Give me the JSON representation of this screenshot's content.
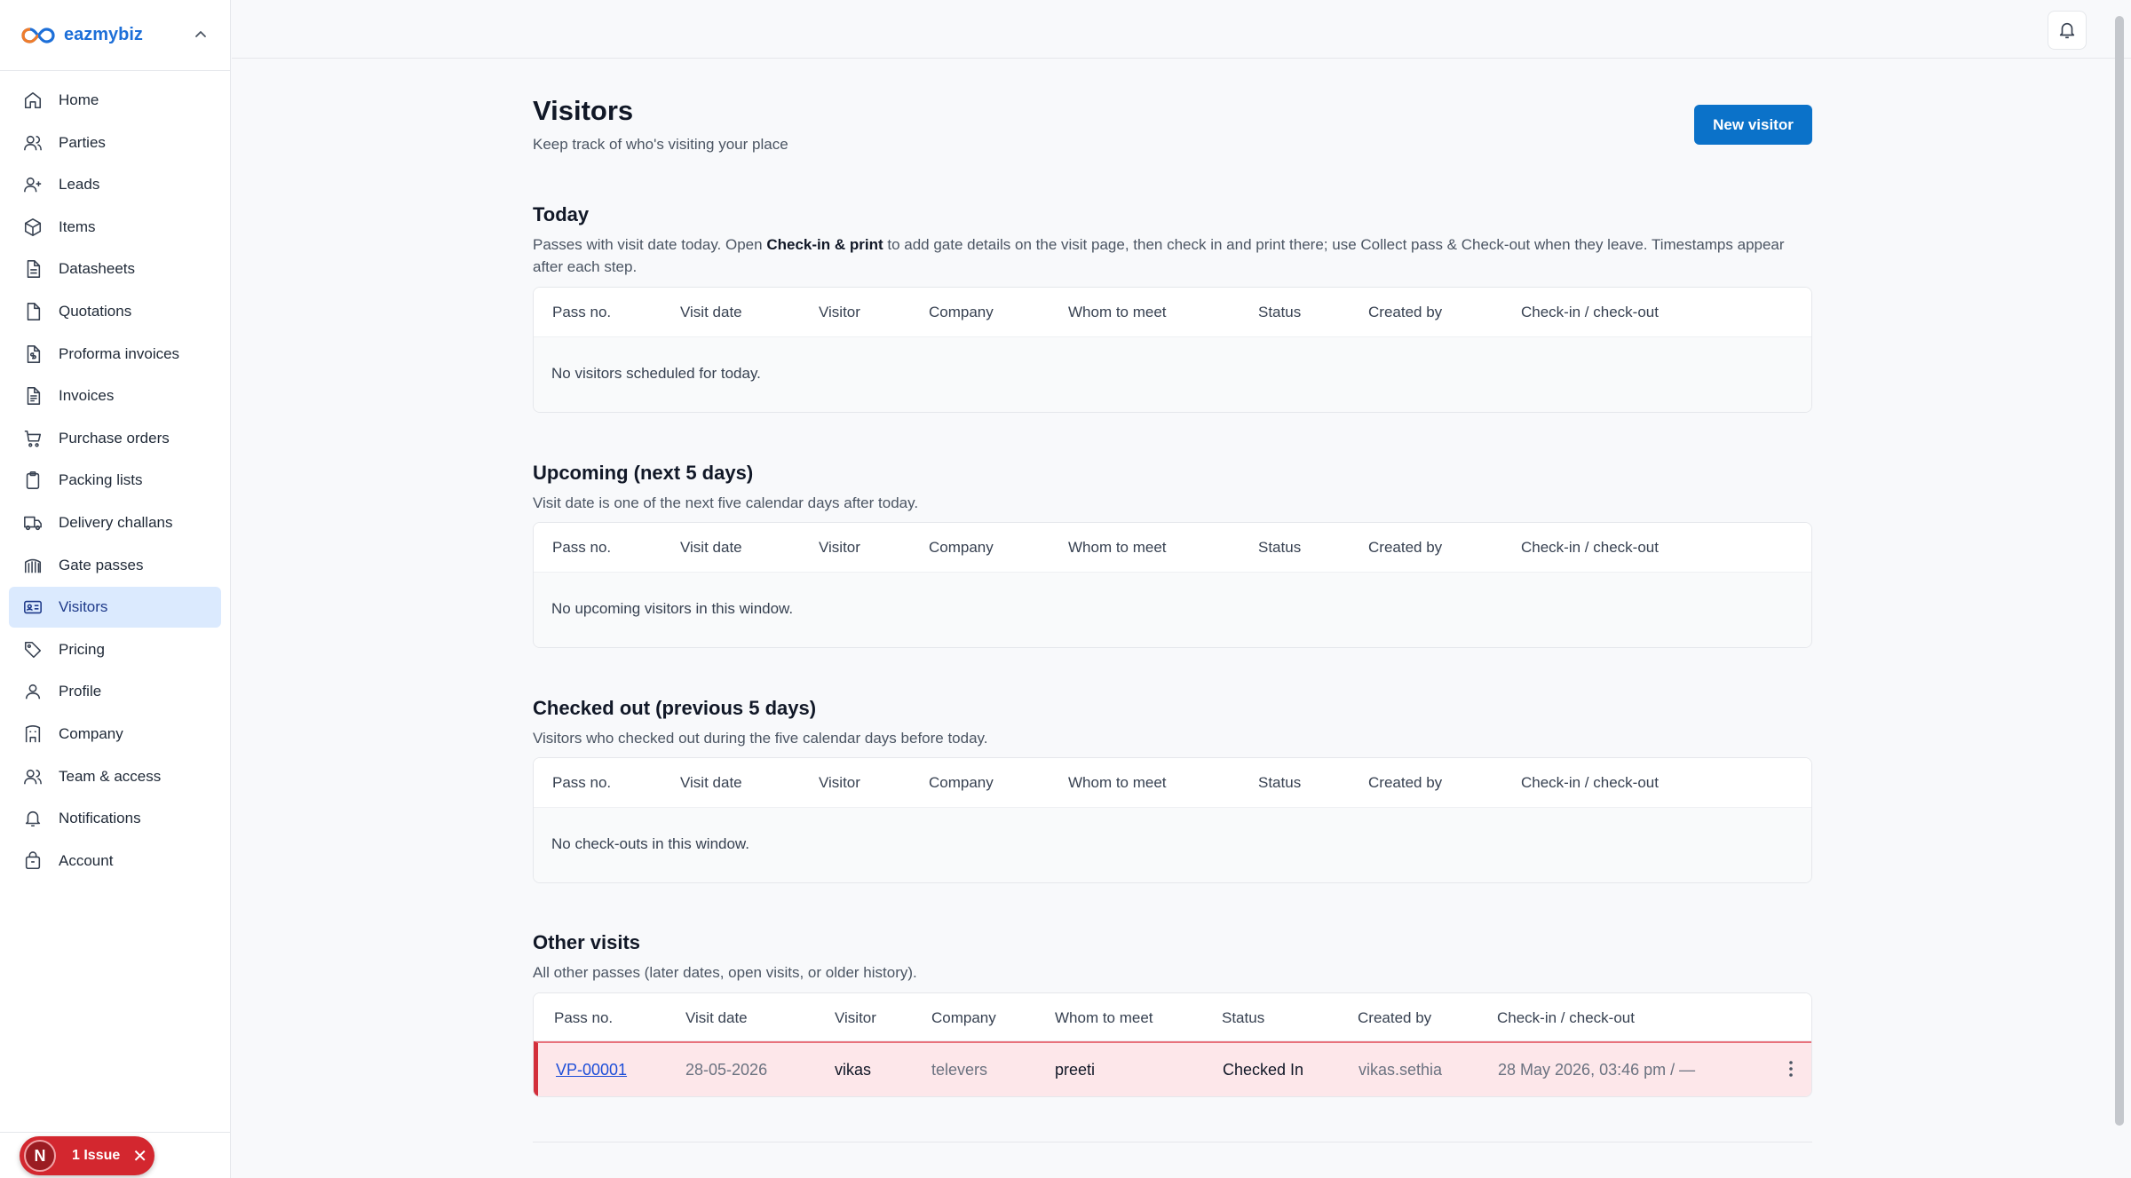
{
  "brand": {
    "name": "eazmybiz"
  },
  "nav": [
    {
      "label": "Home",
      "icon": "home-icon"
    },
    {
      "label": "Parties",
      "icon": "users-icon"
    },
    {
      "label": "Leads",
      "icon": "user-plus-icon"
    },
    {
      "label": "Items",
      "icon": "box-icon"
    },
    {
      "label": "Datasheets",
      "icon": "file-text-icon"
    },
    {
      "label": "Quotations",
      "icon": "file-icon"
    },
    {
      "label": "Proforma invoices",
      "icon": "file-dollar-icon"
    },
    {
      "label": "Invoices",
      "icon": "file-lines-icon"
    },
    {
      "label": "Purchase orders",
      "icon": "cart-icon"
    },
    {
      "label": "Packing lists",
      "icon": "clipboard-icon"
    },
    {
      "label": "Delivery challans",
      "icon": "truck-icon"
    },
    {
      "label": "Gate passes",
      "icon": "gate-icon"
    },
    {
      "label": "Visitors",
      "icon": "id-card-icon",
      "active": true
    },
    {
      "label": "Pricing",
      "icon": "tag-icon"
    },
    {
      "label": "Profile",
      "icon": "user-icon"
    },
    {
      "label": "Company",
      "icon": "building-icon"
    },
    {
      "label": "Team & access",
      "icon": "team-icon"
    },
    {
      "label": "Notifications",
      "icon": "bell-icon"
    },
    {
      "label": "Account",
      "icon": "lock-icon"
    }
  ],
  "issue_badge": {
    "initial": "N",
    "label": "1 Issue",
    "close": "✕"
  },
  "page": {
    "title": "Visitors",
    "subtitle": "Keep track of who's visiting your place",
    "new_button": "New visitor"
  },
  "columns": [
    "Pass no.",
    "Visit date",
    "Visitor",
    "Company",
    "Whom to meet",
    "Status",
    "Created by",
    "Check-in / check-out"
  ],
  "sections": {
    "today": {
      "title": "Today",
      "desc_pre": "Passes with visit date today. Open ",
      "desc_bold": "Check-in & print",
      "desc_post": " to add gate details on the visit page, then check in and print there; use Collect pass & Check-out when they leave. Timestamps appear after each step.",
      "empty": "No visitors scheduled for today."
    },
    "upcoming": {
      "title": "Upcoming (next 5 days)",
      "desc": "Visit date is one of the next five calendar days after today.",
      "empty": "No upcoming visitors in this window."
    },
    "checked_out": {
      "title": "Checked out (previous 5 days)",
      "desc": "Visitors who checked out during the five calendar days before today.",
      "empty": "No check-outs in this window."
    },
    "other": {
      "title": "Other visits",
      "desc": "All other passes (later dates, open visits, or older history).",
      "rows": [
        {
          "pass_no": "VP-00001",
          "visit_date": "28-05-2026",
          "visitor": "vikas",
          "company": "televers",
          "whom": "preeti",
          "status": "Checked In",
          "created_by": "vikas.sethia",
          "check": "28 May 2026, 03:46 pm / —"
        }
      ]
    }
  },
  "colors": {
    "accent": "#0b72c9",
    "brand": "#1d6fd8",
    "active_nav": "#dbeafe",
    "row_alert": "#fde7ea",
    "row_alert_border": "#d32f3b"
  }
}
